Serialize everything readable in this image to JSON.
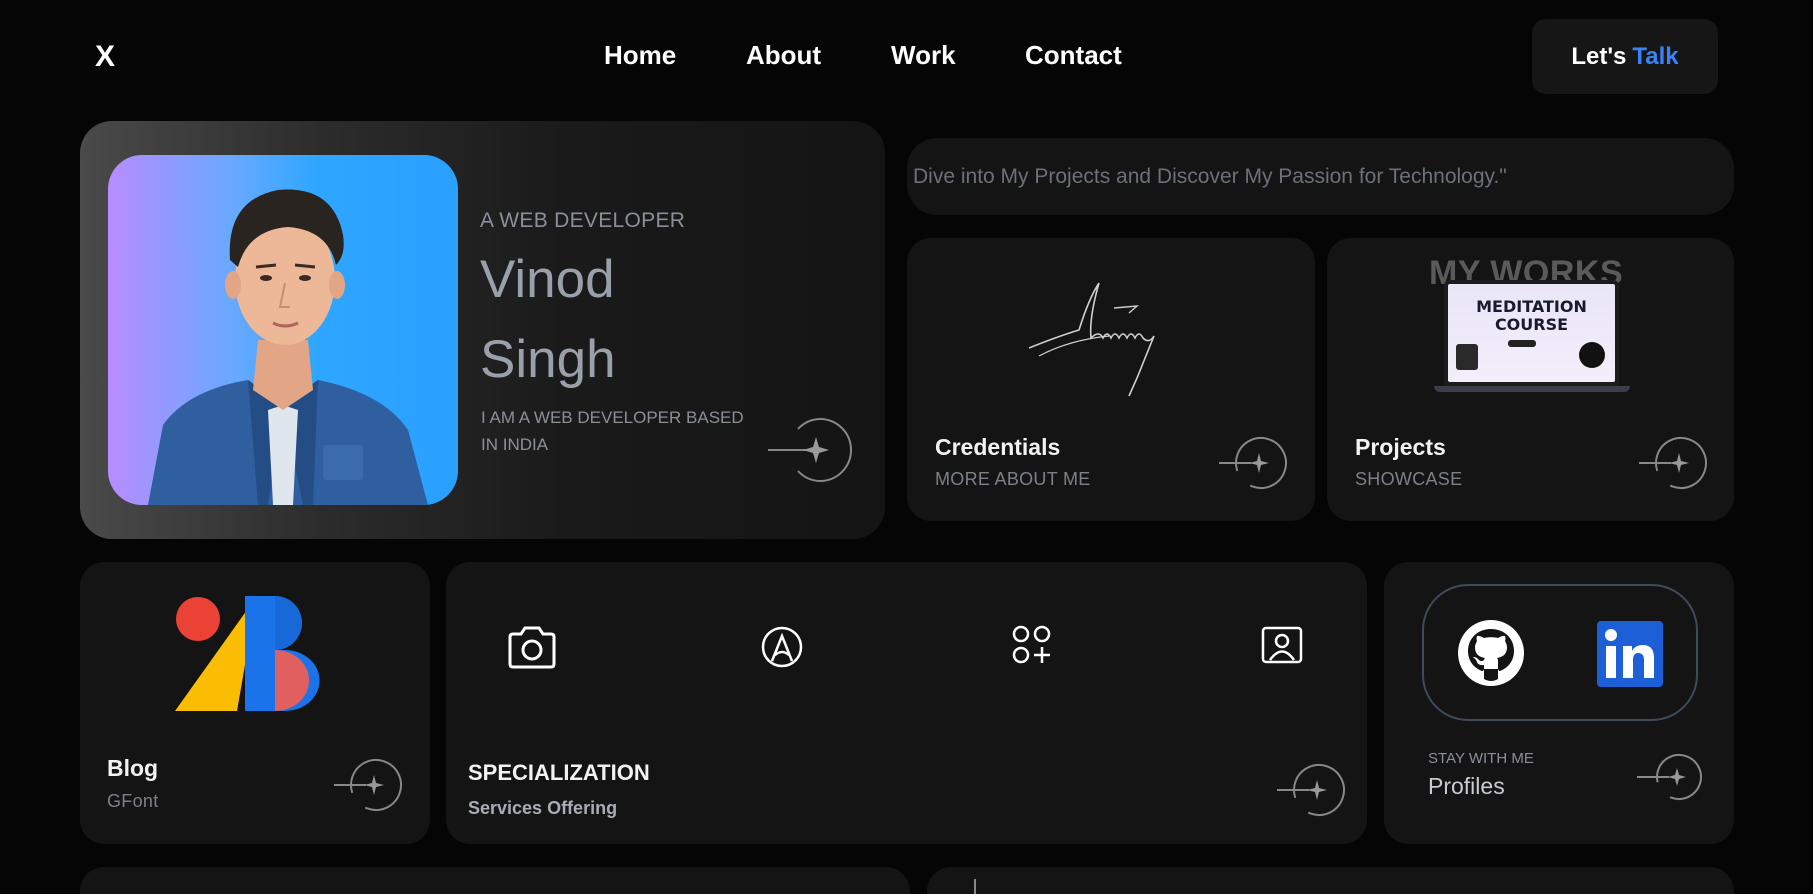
{
  "nav": {
    "logo": "X",
    "links": [
      "Home",
      "About",
      "Work",
      "Contact"
    ],
    "cta_text": "Let's",
    "cta_accent": "Talk"
  },
  "hero": {
    "role": "A WEB DEVELOPER",
    "first_name": "Vinod",
    "last_name": "Singh",
    "description": "I AM A WEB DEVELOPER BASED IN INDIA"
  },
  "tagline": "Dive into My Projects and Discover My Passion for Technology.\"",
  "credentials": {
    "title": "Credentials",
    "subtitle": "MORE ABOUT ME"
  },
  "projects": {
    "title": "Projects",
    "subtitle": "SHOWCASE",
    "banner": "MY WORKS",
    "mockup_title_1": "MEDITATION",
    "mockup_title_2": "COURSE"
  },
  "blog": {
    "title": "Blog",
    "subtitle": "GFont"
  },
  "specialization": {
    "title": "SPECIALIZATION",
    "subtitle": "Services Offering",
    "icons": [
      "camera-icon",
      "design-pen-icon",
      "apps-add-icon",
      "portrait-frame-icon"
    ]
  },
  "profiles": {
    "label": "STAY WITH ME",
    "title": "Profiles",
    "icons": [
      "github-icon",
      "linkedin-icon"
    ]
  },
  "colors": {
    "accent": "#3b82f6",
    "background": "#050505",
    "card": "#141414",
    "linkedin": "#1d5fd6"
  }
}
